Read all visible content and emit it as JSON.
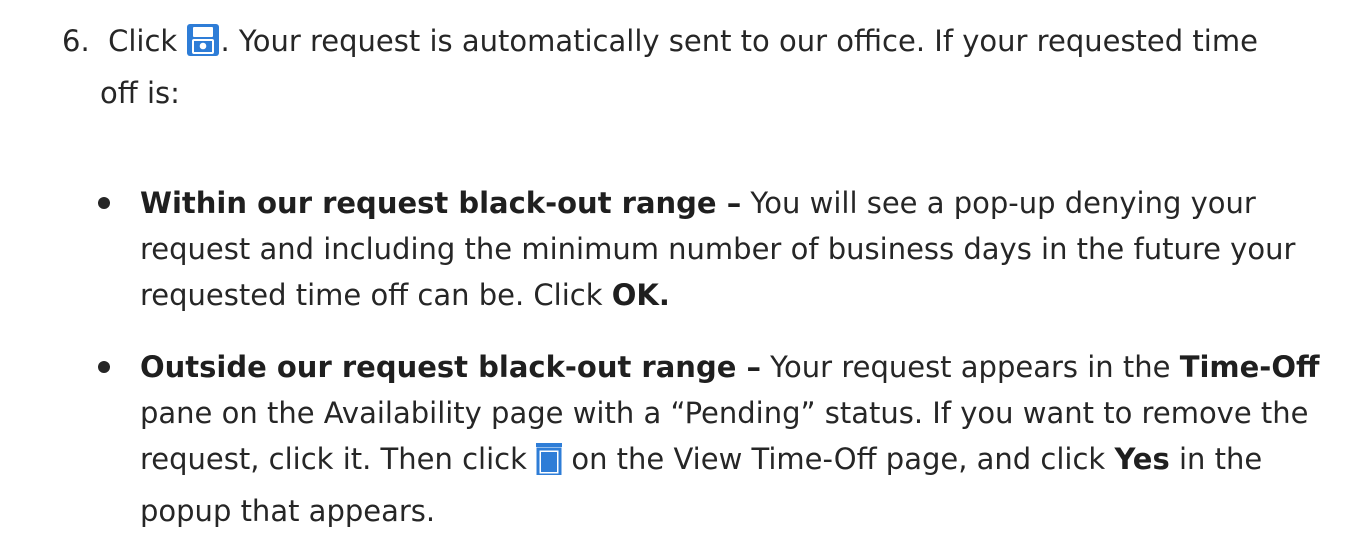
{
  "step": {
    "number": "6.",
    "click_word": "Click",
    "after_icon_text": ". Your request is automatically sent to our office. If your requested time",
    "second_line_text": "off is:",
    "save_icon": "save-icon",
    "icon_color": "#2e7dd7"
  },
  "bullets": [
    {
      "title": "Within our request black-out range –",
      "text_part1": " You will see a pop-up denying your request and including the minimum number of business days in the future your requested time off can be. Click ",
      "bold_end": "OK."
    },
    {
      "title": "Outside our request black-out range –",
      "text_part1": " Your request appears in the ",
      "bold_mid": "Time-Off",
      "text_part2": " pane on the Availability page with a “Pending” status. If you want to remove the request, click it. Then click ",
      "trash_icon": "trash-icon",
      "text_part3": " on the View Time-Off page, and click ",
      "bold_yes": "Yes",
      "text_part4": " in the popup that appears."
    }
  ]
}
